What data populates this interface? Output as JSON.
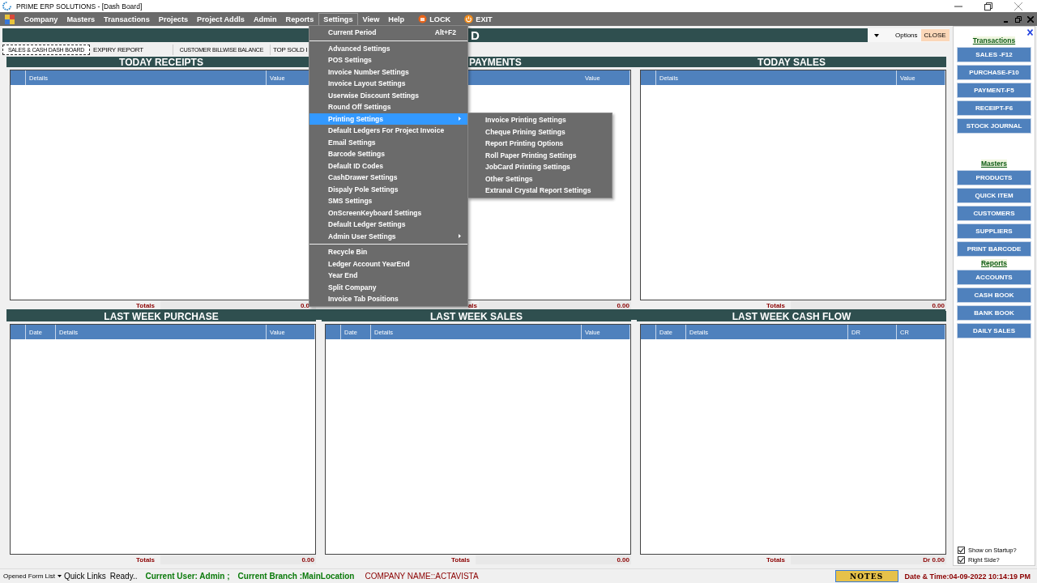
{
  "window": {
    "title": "PRIME ERP SOLUTIONS - [Dash Board]"
  },
  "menubar": [
    {
      "label": "Company",
      "kind": "menu",
      "selected": false
    },
    {
      "label": "Masters",
      "kind": "menu",
      "selected": false
    },
    {
      "label": "Transactions",
      "kind": "menu",
      "selected": false
    },
    {
      "label": "Projects",
      "kind": "menu",
      "selected": false
    },
    {
      "label": "Project Addls",
      "kind": "menu",
      "selected": false
    },
    {
      "label": "Admin",
      "kind": "menu",
      "selected": false
    },
    {
      "label": "Reports",
      "kind": "menu",
      "selected": false
    },
    {
      "label": "Settings",
      "kind": "menu",
      "selected": true
    },
    {
      "label": "View",
      "kind": "menu",
      "selected": false
    },
    {
      "label": "Help",
      "kind": "menu",
      "selected": false
    },
    {
      "label": "LOCK",
      "kind": "lock",
      "selected": false
    },
    {
      "label": "EXIT",
      "kind": "exit",
      "selected": false
    }
  ],
  "header": {
    "title": "D",
    "options": "Options",
    "close": "CLOSE"
  },
  "tabs": [
    {
      "label": "SALES & CASH DASH BOARD",
      "selected": true
    },
    {
      "label": "EXPIRY REPORT",
      "selected": false
    },
    {
      "label": "CUSTOMER BILLWISE BALANCE",
      "selected": false
    },
    {
      "label": "TOP SOLD I",
      "selected": false
    }
  ],
  "panels": [
    {
      "title": "TODAY RECEIPTS",
      "columns": [
        "",
        "Details",
        "Value"
      ],
      "totals_label": "Totals",
      "totals_value": "0.0"
    },
    {
      "title": "PAYMENTS",
      "columns": [
        "Value"
      ],
      "totals_label": "als",
      "totals_value": "0.00"
    },
    {
      "title": "TODAY SALES",
      "columns": [
        "",
        "Details",
        "Value"
      ],
      "totals_label": "Totals",
      "totals_value": "0.00"
    },
    {
      "title": "LAST WEEK PURCHASE",
      "columns": [
        "",
        "Date",
        "Details",
        "Value"
      ],
      "totals_label": "Totals",
      "totals_value": "0.00"
    },
    {
      "title": "LAST WEEK SALES",
      "columns": [
        "",
        "Date",
        "Details",
        "Value"
      ],
      "totals_label": "Totals",
      "totals_value": "0.00"
    },
    {
      "title": "LAST WEEK CASH FLOW",
      "columns": [
        "",
        "Date",
        "Details",
        "DR",
        "CR"
      ],
      "totals_label": "Totals",
      "totals_value": "Dr 0.00"
    }
  ],
  "settings_menu": [
    {
      "kind": "item",
      "label": "Current Period",
      "shortcut": "Alt+F2",
      "selected": false
    },
    {
      "kind": "separator"
    },
    {
      "kind": "item",
      "label": "Advanced Settings",
      "selected": false
    },
    {
      "kind": "item",
      "label": "POS Settings",
      "selected": false
    },
    {
      "kind": "item",
      "label": "Invoice Number Settings",
      "selected": false
    },
    {
      "kind": "item",
      "label": "Invoice Layout Settings",
      "selected": false
    },
    {
      "kind": "item",
      "label": "Userwise Discount Settings",
      "selected": false
    },
    {
      "kind": "item",
      "label": "Round Off Settings",
      "selected": false
    },
    {
      "kind": "submenu",
      "label": "Printing Settings",
      "selected": true
    },
    {
      "kind": "item",
      "label": "Default Ledgers For Project Invoice",
      "selected": false
    },
    {
      "kind": "item",
      "label": "Email Settings",
      "selected": false
    },
    {
      "kind": "item",
      "label": "Barcode Settings",
      "selected": false
    },
    {
      "kind": "item",
      "label": "Default ID Codes",
      "selected": false
    },
    {
      "kind": "item",
      "label": "CashDrawer Settings",
      "selected": false
    },
    {
      "kind": "item",
      "label": "Dispaly Pole Settings",
      "selected": false
    },
    {
      "kind": "item",
      "label": "SMS Settings",
      "selected": false
    },
    {
      "kind": "item",
      "label": "OnScreenKeyboard Settings",
      "selected": false
    },
    {
      "kind": "item",
      "label": "Default Ledger Settings",
      "selected": false
    },
    {
      "kind": "submenu",
      "label": "Admin User Settings",
      "selected": false
    },
    {
      "kind": "separator"
    },
    {
      "kind": "item",
      "label": "Recycle Bin",
      "selected": false
    },
    {
      "kind": "item",
      "label": "Ledger Account YearEnd",
      "selected": false
    },
    {
      "kind": "item",
      "label": "Year End",
      "selected": false
    },
    {
      "kind": "item",
      "label": "Split Company",
      "selected": false
    },
    {
      "kind": "item",
      "label": "Invoice Tab Positions",
      "selected": false
    }
  ],
  "printing_submenu": [
    "Invoice Printing Settings",
    "Cheque Prining Settings",
    "Report Printing Options",
    "Roll Paper Printing Settings",
    "JobCard Printing Settings",
    "Other Settings",
    "Extranal Crystal Report Settings"
  ],
  "sidebar": {
    "sections": [
      {
        "heading": "Transactions",
        "buttons": [
          "SALES -F12",
          "PURCHASE-F10",
          "PAYMENT-F5",
          "RECEIPT-F6",
          "STOCK JOURNAL"
        ]
      },
      {
        "heading": "Masters",
        "buttons": [
          "PRODUCTS",
          "QUICK ITEM",
          "CUSTOMERS",
          "SUPPLIERS",
          "PRINT BARCODE"
        ]
      },
      {
        "heading": "Reports",
        "buttons": [
          "ACCOUNTS",
          "CASH BOOK",
          "BANK BOOK",
          "DAILY SALES"
        ]
      }
    ],
    "options": [
      {
        "label": "Show on Startup?",
        "checked": true
      },
      {
        "label": "Right Side?",
        "checked": true
      }
    ]
  },
  "status_bar": {
    "form_list": "Opened Form List",
    "quick_links": "Quick Links",
    "status": "Ready..",
    "user": "Current User: Admin ;",
    "branch": "Current Branch :MainLocation",
    "company": "COMPANY NAME::ACTAVISTA",
    "notes": "NOTES",
    "datetime": "Date & Time:04-09-2022 10:14:19 PM"
  }
}
